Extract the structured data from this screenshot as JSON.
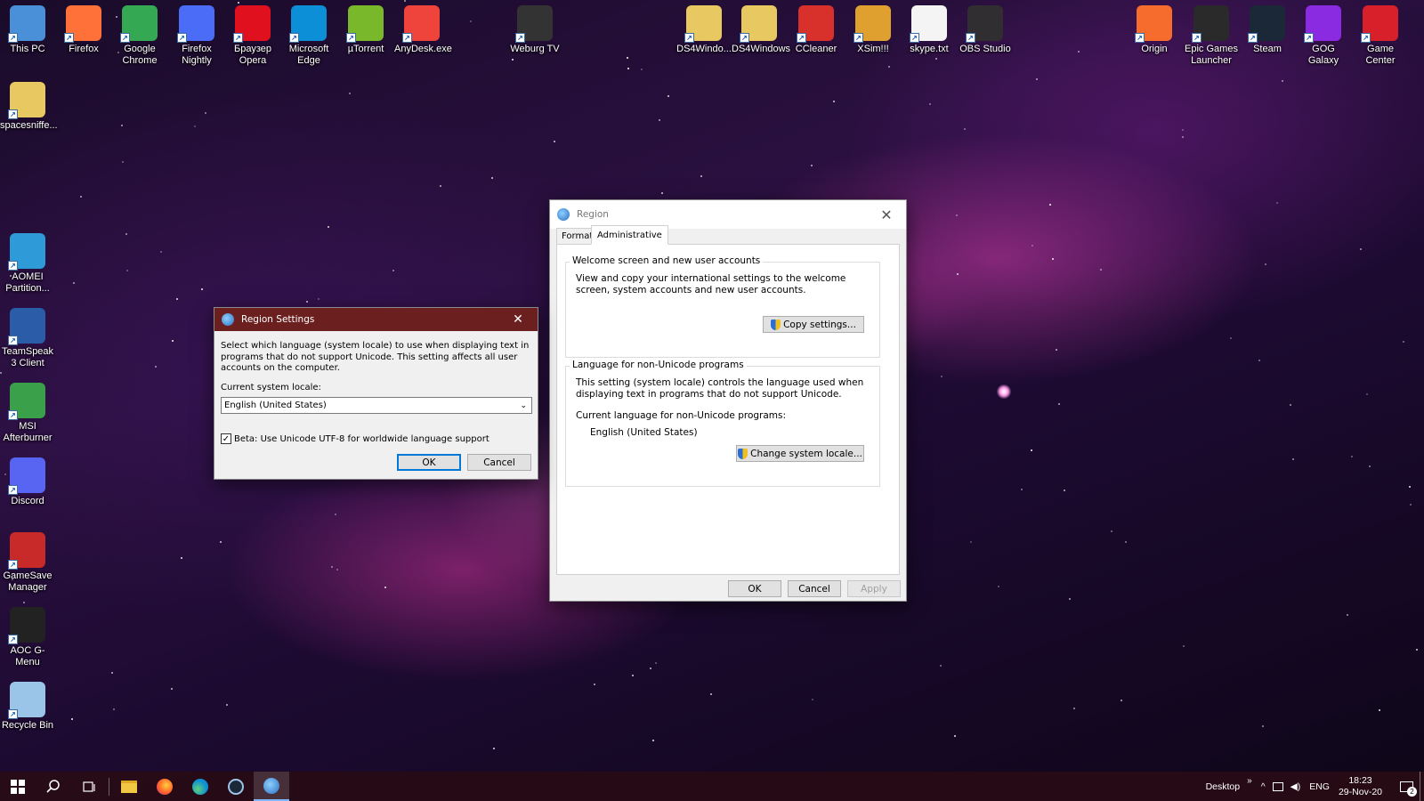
{
  "desktop": {
    "top_icons": [
      {
        "label": "This PC",
        "icon": "this-pc-icon",
        "color": "#4a90d9"
      },
      {
        "label": "Firefox",
        "icon": "firefox-icon",
        "color": "#ff7139"
      },
      {
        "label": "Google Chrome",
        "icon": "chrome-icon",
        "color": "#34a853"
      },
      {
        "label": "Firefox Nightly",
        "icon": "firefox-nightly-icon",
        "color": "#4a6cf7"
      },
      {
        "label": "Браузер Opera",
        "icon": "opera-icon",
        "color": "#e0101e"
      },
      {
        "label": "Microsoft Edge",
        "icon": "edge-icon",
        "color": "#0c8fd6"
      },
      {
        "label": "µTorrent",
        "icon": "utorrent-icon",
        "color": "#78b82a"
      },
      {
        "label": "AnyDesk.exe",
        "icon": "anydesk-icon",
        "color": "#ef443b"
      },
      {
        "label": "Weburg TV",
        "icon": "weburg-icon",
        "color": "#333333"
      },
      {
        "label": "DS4Windo...",
        "icon": "folder-zip-icon",
        "color": "#e8c860"
      },
      {
        "label": "DS4Windows",
        "icon": "ds4windows-icon",
        "color": "#e8c860"
      },
      {
        "label": "CCleaner",
        "icon": "ccleaner-icon",
        "color": "#d8302a"
      },
      {
        "label": "XSim!!!",
        "icon": "folder-zip-icon",
        "color": "#e0a030"
      },
      {
        "label": "skype.txt",
        "icon": "text-file-icon",
        "color": "#f4f4f4"
      },
      {
        "label": "OBS Studio",
        "icon": "obs-icon",
        "color": "#302e31"
      },
      {
        "label": "Origin",
        "icon": "origin-icon",
        "color": "#f56c2d"
      },
      {
        "label": "Epic Games Launcher",
        "icon": "epic-games-icon",
        "color": "#2a2a2a"
      },
      {
        "label": "Steam",
        "icon": "steam-icon",
        "color": "#1b2838"
      },
      {
        "label": "GOG Galaxy",
        "icon": "gog-galaxy-icon",
        "color": "#8a2be2"
      },
      {
        "label": "Game Center",
        "icon": "game-center-icon",
        "color": "#d8202a"
      }
    ],
    "left_icons": [
      {
        "label": "spacesniffe...",
        "icon": "folder-zip-icon",
        "color": "#e8c860"
      },
      {
        "label": "AOMEI Partition...",
        "icon": "aomei-icon",
        "color": "#2e9ad8"
      },
      {
        "label": "TeamSpeak 3 Client",
        "icon": "teamspeak-icon",
        "color": "#2a5ca8"
      },
      {
        "label": "MSI Afterburner",
        "icon": "msi-afterburner-icon",
        "color": "#3aa04a"
      },
      {
        "label": "Discord",
        "icon": "discord-icon",
        "color": "#5865f2"
      },
      {
        "label": "GameSave Manager",
        "icon": "gamesave-manager-icon",
        "color": "#c82a2a"
      },
      {
        "label": "AOC G-Menu",
        "icon": "aoc-gmenu-icon",
        "color": "#222222"
      },
      {
        "label": "Recycle Bin",
        "icon": "recycle-bin-icon",
        "color": "#9ac4e8"
      }
    ]
  },
  "region_dialog": {
    "title": "Region",
    "tabs": [
      "Formats",
      "Administrative"
    ],
    "active_tab": "Administrative",
    "welcome_group": {
      "title": "Welcome screen and new user accounts",
      "description": "View and copy your international settings to the welcome screen, system accounts and new user accounts.",
      "button": "Copy settings..."
    },
    "unicode_group": {
      "title": "Language for non-Unicode programs",
      "description": "This setting (system locale) controls the language used when displaying text in programs that do not support Unicode.",
      "current_label": "Current language for non-Unicode programs:",
      "current_value": "English (United States)",
      "button": "Change system locale..."
    },
    "ok": "OK",
    "cancel": "Cancel",
    "apply": "Apply"
  },
  "region_settings_dialog": {
    "title": "Region Settings",
    "description": "Select which language (system locale) to use when displaying text in programs that do not support Unicode. This setting affects all user accounts on the computer.",
    "locale_label": "Current system locale:",
    "locale_value": "English (United States)",
    "beta_checkbox_label": "Beta: Use Unicode UTF-8 for worldwide language support",
    "beta_checked": true,
    "ok": "OK",
    "cancel": "Cancel",
    "title_color": "#6b1f1f"
  },
  "taskbar": {
    "pinned": [
      "start-icon",
      "search-icon",
      "task-view-icon",
      "file-explorer-icon",
      "firefox-icon",
      "edge-icon",
      "steam-icon",
      "region-settings-icon"
    ],
    "desktop_label": "Desktop",
    "language": "ENG",
    "time": "18:23",
    "date": "29-Nov-20",
    "notification_count": "2"
  }
}
